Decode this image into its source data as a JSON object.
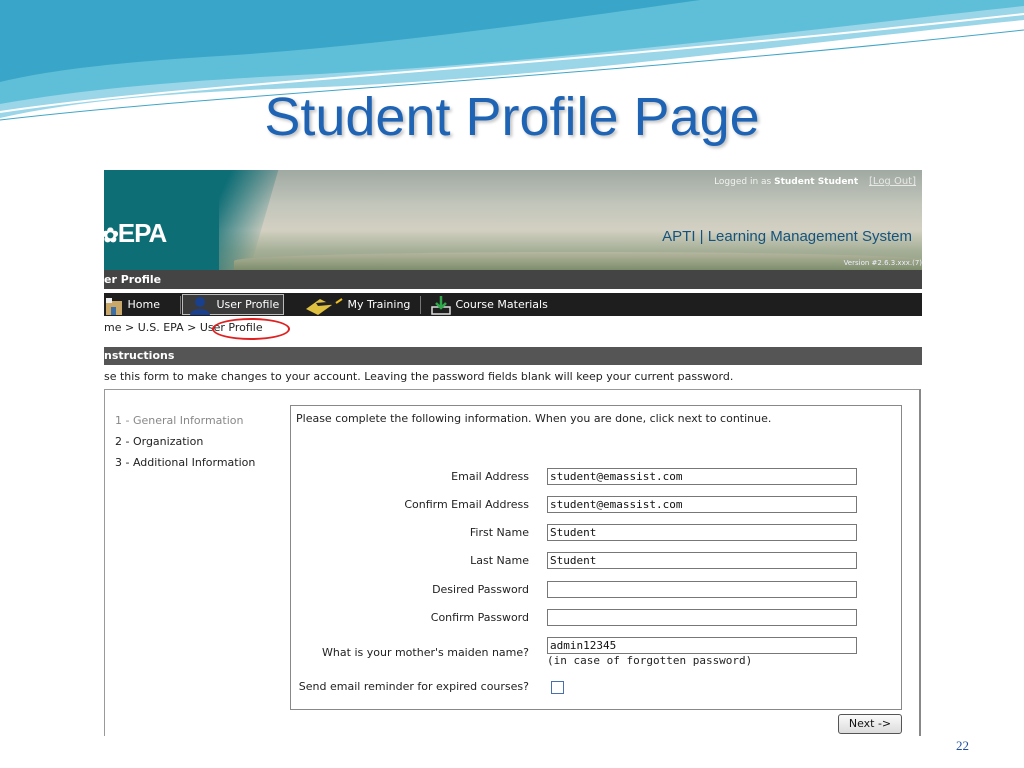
{
  "slide": {
    "title": "Student Profile Page",
    "number": "22"
  },
  "app": {
    "logo": "EPA",
    "login_prefix": "Logged in as",
    "login_user": "Student Student",
    "logout_label": "[Log Out]",
    "system_title": "APTI | Learning Management System",
    "version": "Version #2.6.3.xxx.(7)",
    "page_title": "er Profile"
  },
  "nav": {
    "items": [
      {
        "label": "Home",
        "icon": "home-icon"
      },
      {
        "label": "User Profile",
        "icon": "user-icon"
      },
      {
        "label": "My Training",
        "icon": "graduation-cap-icon"
      },
      {
        "label": "Course Materials",
        "icon": "download-icon"
      }
    ]
  },
  "breadcrumb": {
    "items": [
      "me",
      "U.S. EPA",
      "User Profile"
    ],
    "separator": ">"
  },
  "instructions": {
    "header": "nstructions",
    "text": "se this form to make changes to your account. Leaving the password fields blank will keep your current password."
  },
  "steps": [
    "1 - General Information",
    "2 - Organization",
    "3 - Additional Information"
  ],
  "form": {
    "intro": "Please complete the following information. When you are done, click next to continue.",
    "fields": [
      {
        "label": "Email Address",
        "value": "student@emassist.com"
      },
      {
        "label": "Confirm Email Address",
        "value": "student@emassist.com"
      },
      {
        "label": "First Name",
        "value": "Student"
      },
      {
        "label": "Last Name",
        "value": "Student"
      },
      {
        "label": "Desired Password",
        "value": ""
      },
      {
        "label": "Confirm Password",
        "value": ""
      },
      {
        "label": "What is your mother's maiden name?",
        "value": "admin12345"
      }
    ],
    "maiden_hint": "(in case of forgotten password)",
    "reminder_label": "Send email reminder for expired courses?",
    "reminder_checked": false,
    "next_label": "Next ->"
  },
  "colors": {
    "title": "#1f64b4",
    "teal": "#0e6e76",
    "highlight_circle": "#e02020"
  }
}
